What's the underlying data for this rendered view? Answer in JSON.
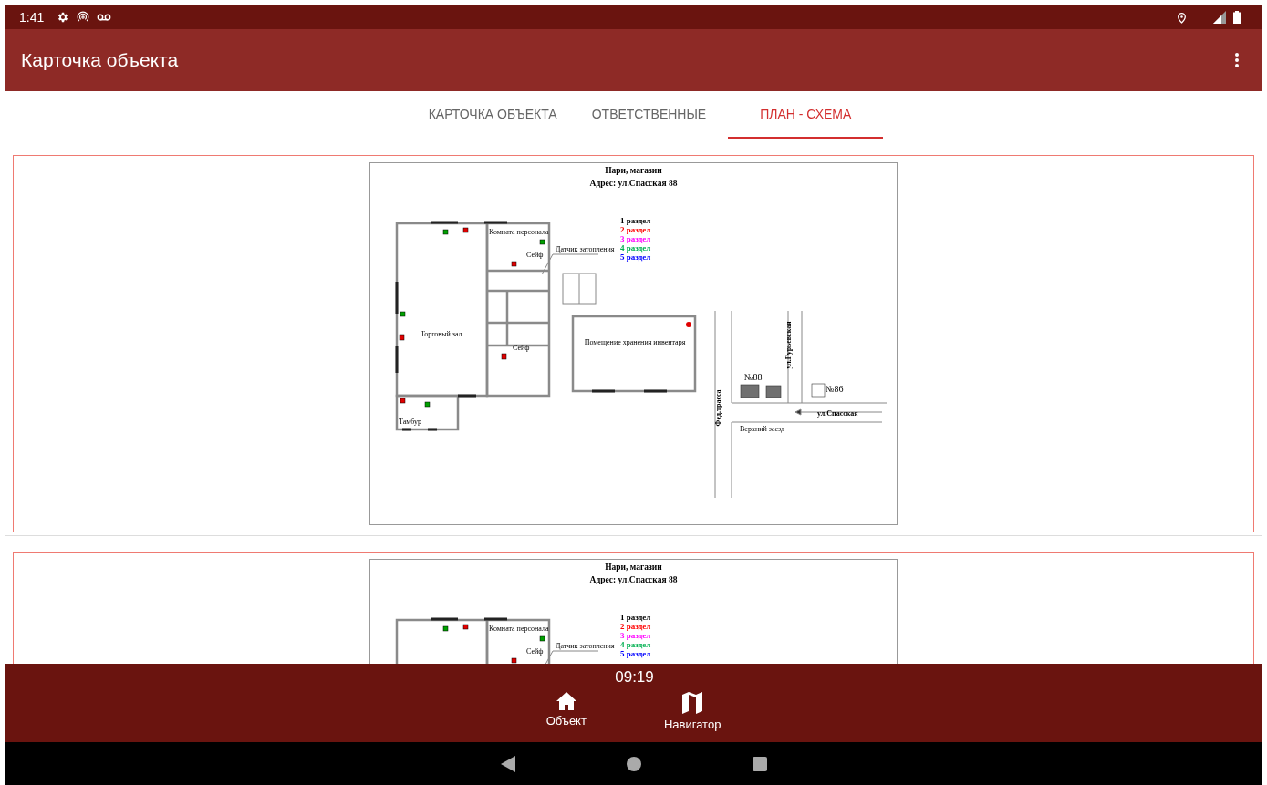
{
  "status_bar": {
    "time": "1:41"
  },
  "app_bar": {
    "title": "Карточка объекта"
  },
  "tabs": [
    {
      "label": "КАРТОЧКА ОБЪЕКТА",
      "selected": false
    },
    {
      "label": "ОТВЕТСТВЕННЫЕ",
      "selected": false
    },
    {
      "label": "ПЛАН - СХЕМА",
      "selected": true
    }
  ],
  "plans": [
    {
      "title": "Нари, магазин",
      "address": "Адрес: ул.Спасская 88",
      "legend": [
        {
          "text": "1 раздел",
          "color": "#000000"
        },
        {
          "text": "2 раздел",
          "color": "#ff0000"
        },
        {
          "text": "3 раздел",
          "color": "#ff00ff"
        },
        {
          "text": "4 раздел",
          "color": "#00b050"
        },
        {
          "text": "5 раздел",
          "color": "#0000ff"
        }
      ],
      "labels": [
        {
          "kind": "staff-room",
          "text": "Комната персонала"
        },
        {
          "kind": "safe-upper",
          "text": "Сейф"
        },
        {
          "kind": "flood-sensor",
          "text": "Датчик затопления"
        },
        {
          "kind": "sales-hall",
          "text": "Торговый зал"
        },
        {
          "kind": "safe-lower",
          "text": "Сейф"
        },
        {
          "kind": "tambour",
          "text": "Тамбур"
        },
        {
          "kind": "storage",
          "text": "Помещение хранения инвентаря"
        },
        {
          "kind": "no88",
          "text": "№88"
        },
        {
          "kind": "no86",
          "text": "№86"
        },
        {
          "kind": "gurievskaya",
          "text": "ул.Гурьевская"
        },
        {
          "kind": "spasskaya",
          "text": "ул.Спасская"
        },
        {
          "kind": "highway",
          "text": "Фед.трасса"
        },
        {
          "kind": "upper-drive",
          "text": "Верхний заезд"
        }
      ]
    },
    {
      "title": "Нари, магазин",
      "address": "Адрес: ул.Спасская 88",
      "legend": [
        {
          "text": "1 раздел",
          "color": "#000000"
        },
        {
          "text": "2 раздел",
          "color": "#ff0000"
        },
        {
          "text": "3 раздел",
          "color": "#ff00ff"
        },
        {
          "text": "4 раздел",
          "color": "#00b050"
        },
        {
          "text": "5 раздел",
          "color": "#0000ff"
        }
      ],
      "labels": [
        {
          "kind": "staff-room",
          "text": "Комната персонала"
        },
        {
          "kind": "safe-upper",
          "text": "Сейф"
        },
        {
          "kind": "flood-sensor",
          "text": "Датчик затопления"
        }
      ]
    }
  ],
  "bottom_bar": {
    "time": "09:19",
    "items": [
      {
        "kind": "home",
        "label": "Объект"
      },
      {
        "kind": "map",
        "label": "Навигатор"
      }
    ]
  }
}
